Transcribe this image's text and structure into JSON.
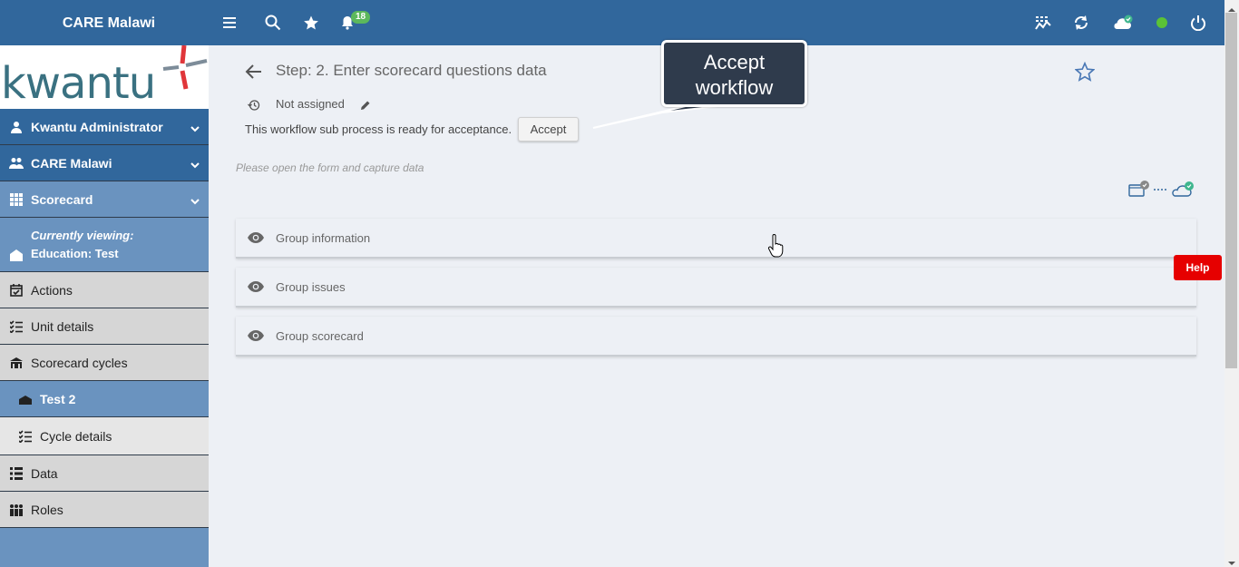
{
  "topbar": {
    "org_title": "CARE Malawi",
    "notification_count": "18",
    "accent": "#31679c"
  },
  "sidebar": {
    "logo_text": "kwantu",
    "items": [
      {
        "label": "Kwantu Administrator",
        "icon": "person-icon"
      },
      {
        "label": "CARE Malawi",
        "icon": "people-icon"
      },
      {
        "label": "Scorecard",
        "icon": "grid-icon"
      },
      {
        "label": "Actions",
        "icon": "calendar-check-icon"
      },
      {
        "label": "Unit details",
        "icon": "checklist-icon"
      },
      {
        "label": "Scorecard cycles",
        "icon": "school-icon"
      },
      {
        "label": "Test 2",
        "icon": "school-icon"
      },
      {
        "label": "Cycle details",
        "icon": "checklist-icon"
      },
      {
        "label": "Data",
        "icon": "list-icon"
      },
      {
        "label": "Roles",
        "icon": "group-icon"
      }
    ],
    "viewing_label": "Currently viewing:",
    "viewing_value": "Education: Test"
  },
  "main": {
    "step_title": "Step: 2. Enter scorecard questions data",
    "assignment": "Not assigned",
    "ready_text": "This workflow sub process is ready for acceptance.",
    "accept_label": "Accept",
    "hint": "Please open the form and capture data",
    "groups": [
      "Group information",
      "Group issues",
      "Group scorecard"
    ]
  },
  "callout": {
    "line1": "Accept",
    "line2": "workflow"
  },
  "help_label": "Help"
}
